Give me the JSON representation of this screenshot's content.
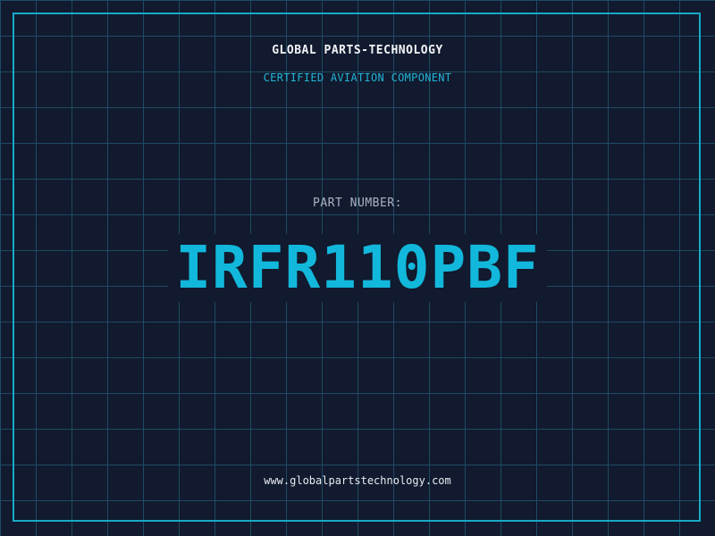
{
  "header": {
    "brand": "GLOBAL PARTS-TECHNOLOGY",
    "subtitle": "CERTIFIED AVIATION COMPONENT"
  },
  "part": {
    "label": "PART NUMBER:",
    "number": "IRFR110PBF"
  },
  "footer": {
    "website": "www.globalpartstechnology.com"
  },
  "colors": {
    "background": "#111a2e",
    "grid": "#1f4a63",
    "frame": "#18a9c9",
    "accent": "#12b8dc",
    "brand_text": "#f2f4f7",
    "label_text": "#aab3c2"
  }
}
